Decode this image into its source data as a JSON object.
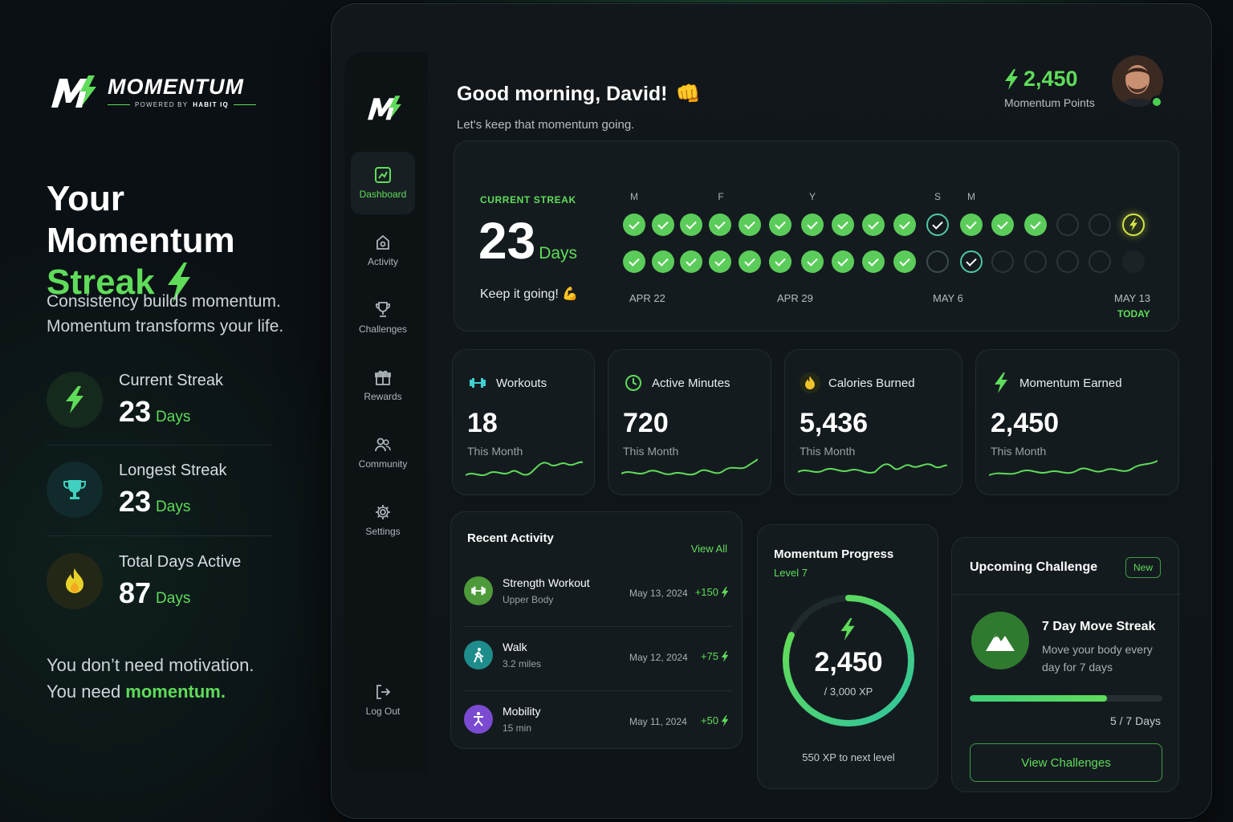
{
  "brand": {
    "name": "MOMENTUM",
    "powered_prefix": "POWERED BY",
    "powered_by": "HABIT IQ"
  },
  "hero": {
    "title_line1": "Your Momentum",
    "title_line2": "Streak",
    "desc_line1": "Consistency builds momentum.",
    "desc_line2": "Momentum transforms your life."
  },
  "summary_stats": [
    {
      "label": "Current Streak",
      "value": "23",
      "unit": "Days",
      "icon": "bolt-icon"
    },
    {
      "label": "Longest Streak",
      "value": "23",
      "unit": "Days",
      "icon": "trophy-icon"
    },
    {
      "label": "Total Days Active",
      "value": "87",
      "unit": "Days",
      "icon": "flame-icon"
    }
  ],
  "tagline": {
    "line1": "You don’t need motivation.",
    "line2_prefix": "You need ",
    "line2_highlight": "momentum."
  },
  "sidebar": {
    "items": [
      {
        "label": "Dashboard",
        "icon": "dashboard-icon",
        "active": true
      },
      {
        "label": "Activity",
        "icon": "activity-icon"
      },
      {
        "label": "Challenges",
        "icon": "trophy-icon"
      },
      {
        "label": "Rewards",
        "icon": "gift-icon"
      },
      {
        "label": "Community",
        "icon": "community-icon"
      },
      {
        "label": "Settings",
        "icon": "gear-icon"
      }
    ],
    "logout": "Log Out"
  },
  "header": {
    "greeting": "Good morning, David!",
    "greeting_emoji": "👊",
    "subtitle": "Let's keep that momentum going.",
    "points_value": "2,450",
    "points_label": "Momentum Points"
  },
  "streak": {
    "label": "CURRENT STREAK",
    "value": "23",
    "unit": "Days",
    "encourage": "Keep it going!",
    "encourage_emoji": "💪",
    "day_letters": [
      "M",
      "F",
      "Y",
      "S",
      "M"
    ],
    "row1": [
      "done",
      "done",
      "done",
      "done",
      "done",
      "done",
      "done",
      "done",
      "done",
      "done",
      "ring",
      "done",
      "done",
      "done",
      "empty",
      "empty",
      "today"
    ],
    "row2": [
      "done",
      "done",
      "done",
      "done",
      "done",
      "done",
      "done",
      "done",
      "done",
      "done",
      "ringdim",
      "ringcheck",
      "empty",
      "empty",
      "empty",
      "empty",
      "faint"
    ],
    "dates": [
      "APR 22",
      "APR 29",
      "MAY 6",
      "MAY 13"
    ],
    "today_label": "TODAY"
  },
  "stats": [
    {
      "title": "Workouts",
      "value": "18",
      "sub": "This Month",
      "icon": "dumbbell-icon"
    },
    {
      "title": "Active Minutes",
      "value": "720",
      "sub": "This Month",
      "icon": "clock-icon"
    },
    {
      "title": "Calories Burned",
      "value": "5,436",
      "sub": "This Month",
      "icon": "flame-icon"
    },
    {
      "title": "Momentum Earned",
      "value": "2,450",
      "sub": "This Month",
      "icon": "bolt-icon"
    }
  ],
  "recent": {
    "title": "Recent Activity",
    "view_all": "View All",
    "items": [
      {
        "name": "Strength Workout",
        "sub": "Upper Body",
        "date": "May 13, 2024",
        "points": "+150",
        "icon": "dumbbell-icon",
        "color": "#4e9a3a"
      },
      {
        "name": "Walk",
        "sub": "3.2 miles",
        "date": "May 12, 2024",
        "points": "+75",
        "icon": "walk-icon",
        "color": "#1f8c8c"
      },
      {
        "name": "Mobility",
        "sub": "15 min",
        "date": "May 11, 2024",
        "points": "+50",
        "icon": "mobility-icon",
        "color": "#7a4bd1"
      }
    ]
  },
  "progress": {
    "title": "Momentum Progress",
    "level": "Level 7",
    "value": "2,450",
    "total": "/ 3,000 XP",
    "next": "550 XP to next level",
    "fraction": 0.8167
  },
  "challenge": {
    "title": "Upcoming Challenge",
    "badge": "New",
    "name": "7 Day Move Streak",
    "desc": "Move your body every day for 7 days",
    "progress_text": "5 / 7 Days",
    "progress_fraction": 0.714,
    "button": "View Challenges"
  },
  "colors": {
    "accent": "#5fdc5a",
    "background": "#0b1014",
    "card": "#141b1f"
  }
}
